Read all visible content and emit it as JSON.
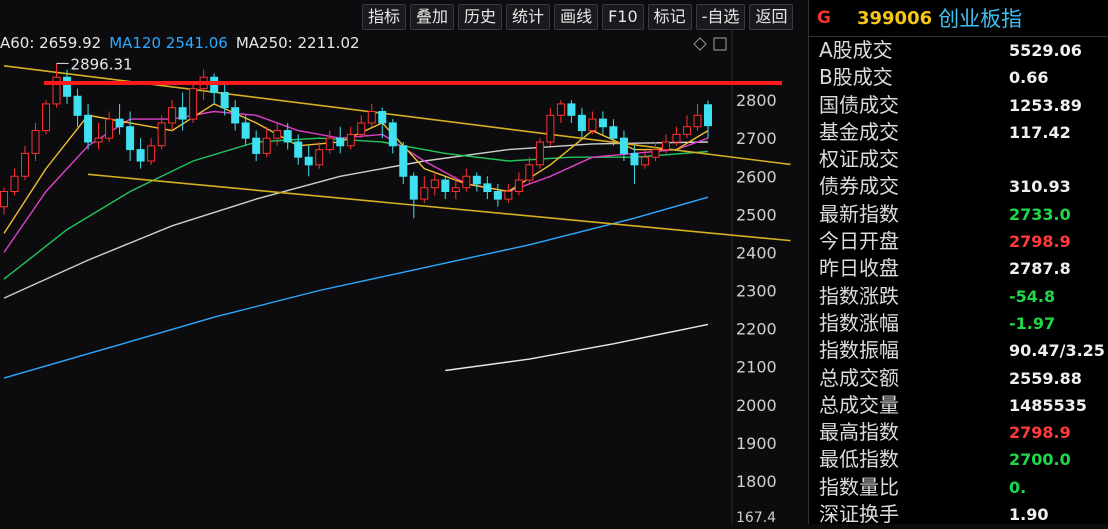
{
  "toolbar": [
    {
      "id": "indicator",
      "label": "指标"
    },
    {
      "id": "overlay",
      "label": "叠加"
    },
    {
      "id": "history",
      "label": "历史"
    },
    {
      "id": "stats",
      "label": "统计"
    },
    {
      "id": "drawline",
      "label": "画线"
    },
    {
      "id": "f10",
      "label": "F10"
    },
    {
      "id": "mark",
      "label": "标记"
    },
    {
      "id": "selfselect",
      "label": "-自选"
    },
    {
      "id": "back",
      "label": "返回"
    }
  ],
  "ma_legend": [
    {
      "text": "A60: 2659.92",
      "color": "#e8e8e8"
    },
    {
      "text": "MA120  2541.06",
      "color": "#2ea8ff"
    },
    {
      "text": "MA250: 2211.02",
      "color": "#e8e8e8"
    }
  ],
  "ticker": {
    "flag": "G",
    "code": "399006",
    "name": "创业板指"
  },
  "stats": [
    {
      "label": "A股成交",
      "value": "5529.06",
      "color": "white"
    },
    {
      "label": "B股成交",
      "value": "0.66",
      "color": "white"
    },
    {
      "label": "国债成交",
      "value": "1253.89",
      "color": "white"
    },
    {
      "label": "基金成交",
      "value": "117.42",
      "color": "white"
    },
    {
      "label": "权证成交",
      "value": "",
      "color": "white"
    },
    {
      "label": "债券成交",
      "value": "310.93",
      "color": "white"
    },
    {
      "label": "最新指数",
      "value": "2733.0",
      "color": "green"
    },
    {
      "label": "今日开盘",
      "value": "2798.9",
      "color": "red"
    },
    {
      "label": "昨日收盘",
      "value": "2787.8",
      "color": "white"
    },
    {
      "label": "指数涨跌",
      "value": "-54.8",
      "color": "green"
    },
    {
      "label": "指数涨幅",
      "value": "-1.97",
      "color": "green"
    },
    {
      "label": "指数振幅",
      "value": "90.47/3.25",
      "color": "white"
    },
    {
      "label": "总成交额",
      "value": "2559.88",
      "color": "white"
    },
    {
      "label": "总成交量",
      "value": "1485535",
      "color": "white"
    },
    {
      "label": "最高指数",
      "value": "2798.9",
      "color": "red"
    },
    {
      "label": "最低指数",
      "value": "2700.0",
      "color": "green"
    },
    {
      "label": "指数量比",
      "value": "0.",
      "color": "green"
    },
    {
      "label": "深证换手",
      "value": "1.90",
      "color": "white"
    }
  ],
  "chart_data": {
    "type": "candlestick",
    "ylim": [
      1750,
      2900
    ],
    "yticks": [
      "2800",
      "2700",
      "2600",
      "2500",
      "2400",
      "2300",
      "2200",
      "2100",
      "2000",
      "1900",
      "1800"
    ],
    "bottom_readout": "167.4",
    "high_marker": {
      "label": "2896.31",
      "value": 2896.31
    },
    "resistance_level": 2845,
    "upper_trendline": [
      [
        0,
        2890
      ],
      [
        72,
        2610
      ]
    ],
    "lower_trendline": [
      [
        8,
        2605
      ],
      [
        72,
        2410
      ]
    ],
    "candles": [
      [
        2520,
        2560,
        2500,
        2570
      ],
      [
        2560,
        2600,
        2550,
        2620
      ],
      [
        2600,
        2660,
        2590,
        2680
      ],
      [
        2660,
        2720,
        2640,
        2740
      ],
      [
        2720,
        2790,
        2710,
        2800
      ],
      [
        2790,
        2860,
        2780,
        2896
      ],
      [
        2860,
        2810,
        2790,
        2880
      ],
      [
        2810,
        2760,
        2730,
        2830
      ],
      [
        2760,
        2690,
        2670,
        2790
      ],
      [
        2690,
        2700,
        2670,
        2740
      ],
      [
        2700,
        2750,
        2690,
        2770
      ],
      [
        2750,
        2730,
        2710,
        2790
      ],
      [
        2730,
        2670,
        2640,
        2770
      ],
      [
        2670,
        2640,
        2620,
        2700
      ],
      [
        2640,
        2680,
        2630,
        2700
      ],
      [
        2680,
        2740,
        2670,
        2760
      ],
      [
        2740,
        2780,
        2720,
        2800
      ],
      [
        2780,
        2750,
        2720,
        2820
      ],
      [
        2750,
        2830,
        2740,
        2850
      ],
      [
        2830,
        2860,
        2800,
        2880
      ],
      [
        2860,
        2820,
        2790,
        2870
      ],
      [
        2820,
        2780,
        2760,
        2850
      ],
      [
        2780,
        2740,
        2720,
        2800
      ],
      [
        2740,
        2700,
        2680,
        2760
      ],
      [
        2700,
        2660,
        2640,
        2720
      ],
      [
        2660,
        2700,
        2650,
        2730
      ],
      [
        2700,
        2720,
        2680,
        2740
      ],
      [
        2720,
        2690,
        2670,
        2740
      ],
      [
        2690,
        2650,
        2630,
        2710
      ],
      [
        2650,
        2630,
        2600,
        2680
      ],
      [
        2630,
        2670,
        2620,
        2690
      ],
      [
        2670,
        2700,
        2660,
        2720
      ],
      [
        2700,
        2680,
        2660,
        2730
      ],
      [
        2680,
        2710,
        2670,
        2730
      ],
      [
        2710,
        2740,
        2700,
        2760
      ],
      [
        2740,
        2770,
        2730,
        2790
      ],
      [
        2770,
        2740,
        2700,
        2780
      ],
      [
        2740,
        2680,
        2660,
        2750
      ],
      [
        2680,
        2600,
        2580,
        2690
      ],
      [
        2600,
        2540,
        2490,
        2610
      ],
      [
        2540,
        2570,
        2530,
        2600
      ],
      [
        2570,
        2590,
        2550,
        2610
      ],
      [
        2590,
        2560,
        2540,
        2600
      ],
      [
        2560,
        2570,
        2540,
        2600
      ],
      [
        2570,
        2600,
        2560,
        2620
      ],
      [
        2600,
        2580,
        2560,
        2610
      ],
      [
        2580,
        2560,
        2540,
        2600
      ],
      [
        2560,
        2540,
        2520,
        2580
      ],
      [
        2540,
        2560,
        2530,
        2580
      ],
      [
        2560,
        2590,
        2550,
        2610
      ],
      [
        2590,
        2630,
        2580,
        2650
      ],
      [
        2630,
        2690,
        2620,
        2700
      ],
      [
        2690,
        2760,
        2680,
        2780
      ],
      [
        2760,
        2790,
        2740,
        2800
      ],
      [
        2790,
        2760,
        2740,
        2800
      ],
      [
        2760,
        2720,
        2700,
        2780
      ],
      [
        2720,
        2750,
        2710,
        2770
      ],
      [
        2750,
        2730,
        2710,
        2770
      ],
      [
        2730,
        2700,
        2680,
        2750
      ],
      [
        2700,
        2660,
        2640,
        2720
      ],
      [
        2660,
        2630,
        2580,
        2680
      ],
      [
        2630,
        2650,
        2620,
        2670
      ],
      [
        2650,
        2670,
        2640,
        2690
      ],
      [
        2670,
        2690,
        2660,
        2710
      ],
      [
        2690,
        2710,
        2680,
        2730
      ],
      [
        2710,
        2730,
        2700,
        2760
      ],
      [
        2730,
        2760,
        2720,
        2790
      ],
      [
        2787.8,
        2733,
        2700,
        2798.9
      ]
    ],
    "series": [
      {
        "name": "MA120",
        "color": "#2ea8ff",
        "points": [
          [
            0,
            2070
          ],
          [
            10,
            2150
          ],
          [
            20,
            2230
          ],
          [
            30,
            2300
          ],
          [
            40,
            2360
          ],
          [
            50,
            2420
          ],
          [
            60,
            2490
          ],
          [
            67,
            2545
          ]
        ]
      },
      {
        "name": "MA250",
        "color": "#e8e8e8",
        "points": [
          [
            42,
            2090
          ],
          [
            50,
            2120
          ],
          [
            58,
            2160
          ],
          [
            67,
            2211
          ]
        ]
      },
      {
        "color": "#cfcfcf",
        "points": [
          [
            0,
            2280
          ],
          [
            8,
            2380
          ],
          [
            16,
            2470
          ],
          [
            24,
            2540
          ],
          [
            32,
            2600
          ],
          [
            40,
            2640
          ],
          [
            48,
            2670
          ],
          [
            56,
            2685
          ],
          [
            67,
            2690
          ]
        ]
      },
      {
        "color": "#22c55e",
        "points": [
          [
            0,
            2330
          ],
          [
            6,
            2460
          ],
          [
            12,
            2560
          ],
          [
            18,
            2640
          ],
          [
            24,
            2690
          ],
          [
            30,
            2700
          ],
          [
            36,
            2690
          ],
          [
            42,
            2660
          ],
          [
            48,
            2640
          ],
          [
            54,
            2650
          ],
          [
            60,
            2650
          ],
          [
            67,
            2665
          ]
        ]
      },
      {
        "color": "#e040c8",
        "points": [
          [
            0,
            2400
          ],
          [
            4,
            2560
          ],
          [
            8,
            2680
          ],
          [
            12,
            2750
          ],
          [
            16,
            2750
          ],
          [
            20,
            2770
          ],
          [
            24,
            2760
          ],
          [
            28,
            2720
          ],
          [
            32,
            2700
          ],
          [
            36,
            2710
          ],
          [
            40,
            2640
          ],
          [
            44,
            2580
          ],
          [
            48,
            2560
          ],
          [
            52,
            2600
          ],
          [
            56,
            2650
          ],
          [
            60,
            2660
          ],
          [
            64,
            2670
          ],
          [
            67,
            2700
          ]
        ]
      },
      {
        "color": "#f0c030",
        "points": [
          [
            0,
            2450
          ],
          [
            4,
            2620
          ],
          [
            8,
            2760
          ],
          [
            12,
            2740
          ],
          [
            16,
            2720
          ],
          [
            20,
            2790
          ],
          [
            24,
            2740
          ],
          [
            28,
            2680
          ],
          [
            32,
            2690
          ],
          [
            36,
            2740
          ],
          [
            40,
            2620
          ],
          [
            44,
            2580
          ],
          [
            48,
            2560
          ],
          [
            52,
            2630
          ],
          [
            56,
            2720
          ],
          [
            60,
            2670
          ],
          [
            64,
            2670
          ],
          [
            67,
            2720
          ]
        ]
      }
    ]
  }
}
